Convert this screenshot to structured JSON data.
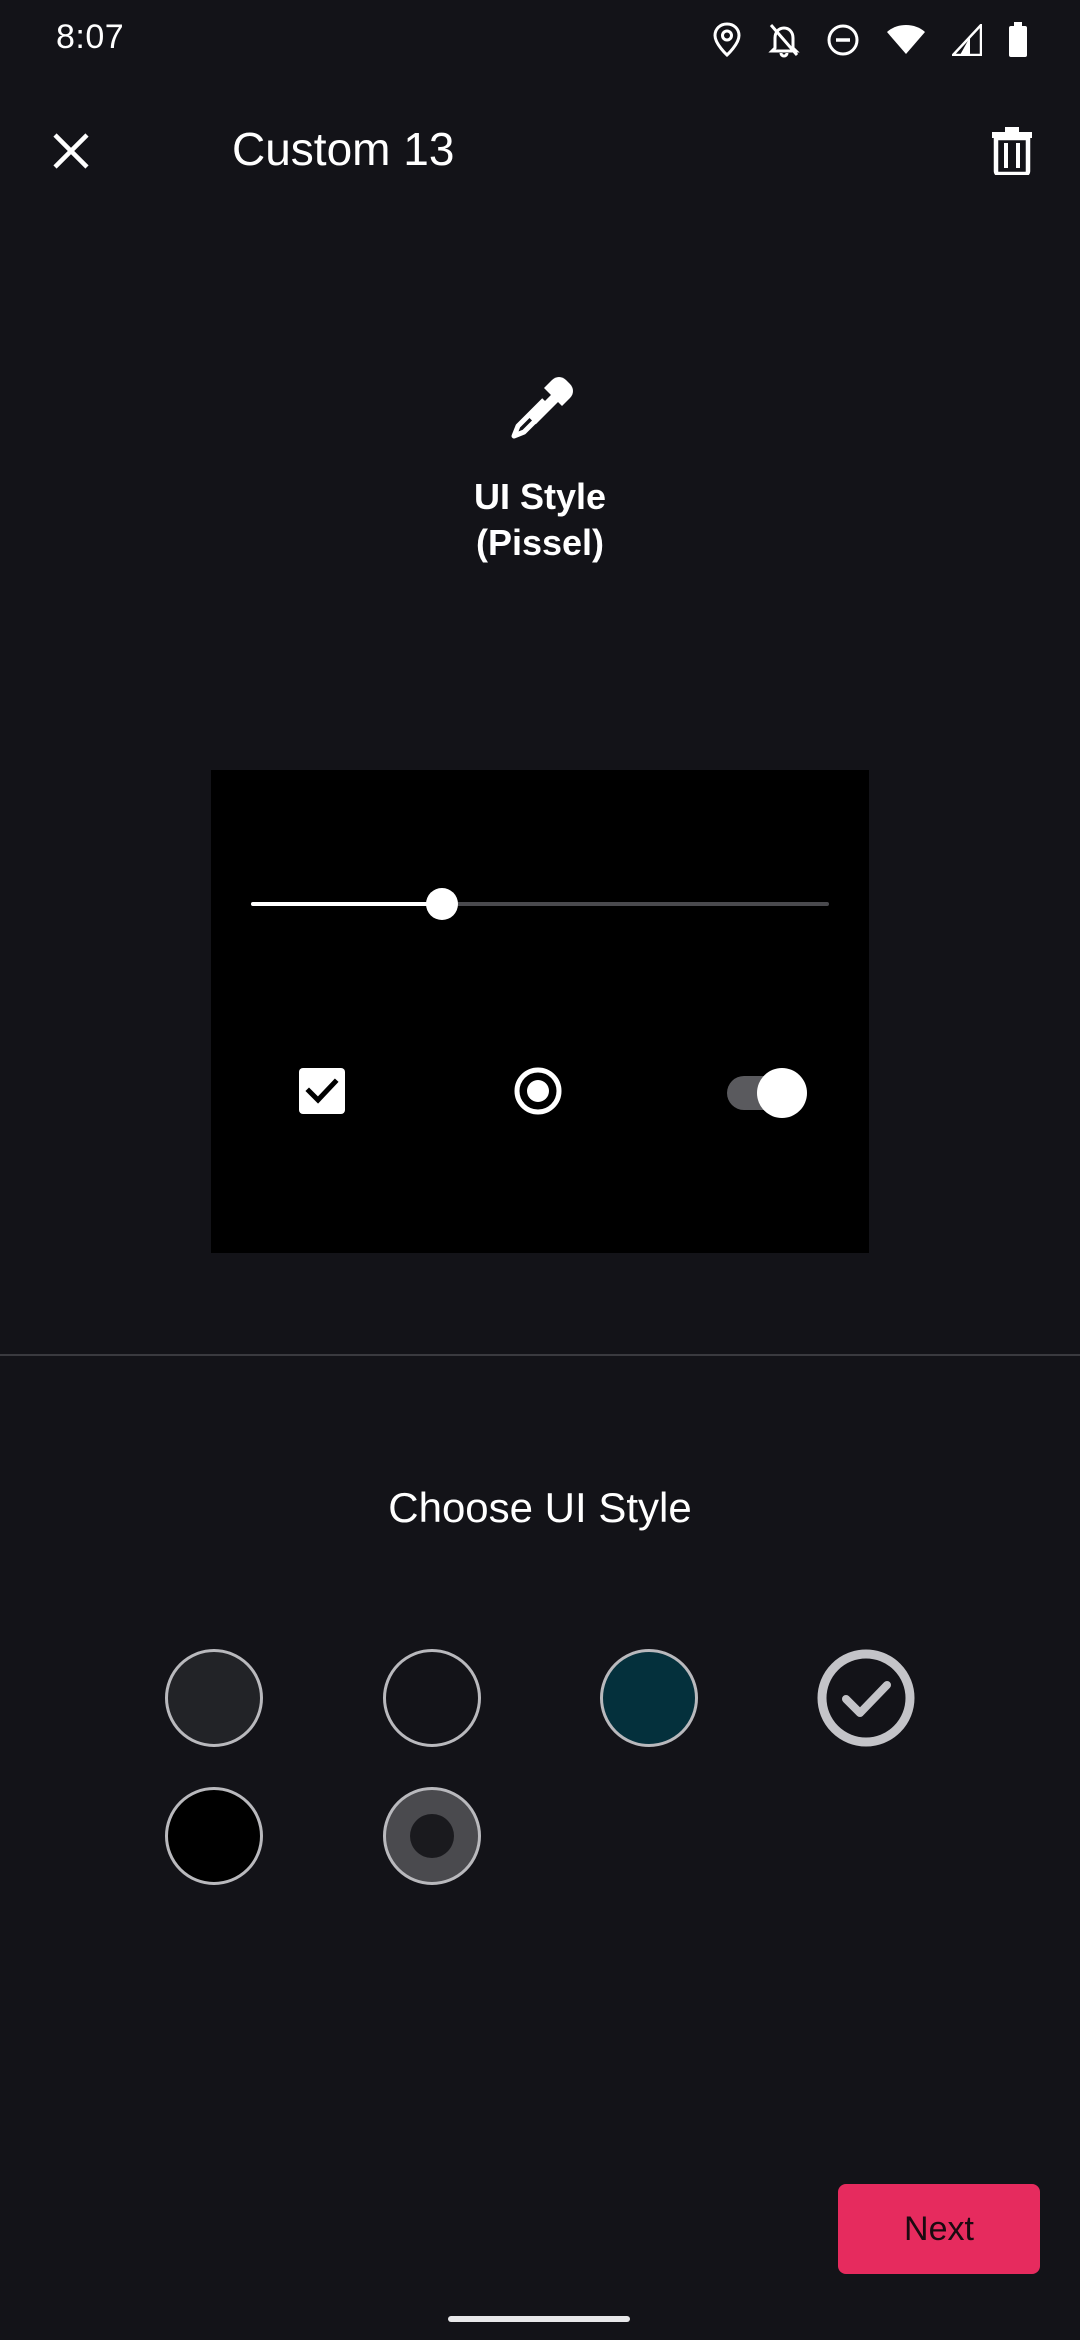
{
  "status_bar": {
    "time": "8:07",
    "icons": [
      "location-icon",
      "notifications-off-icon",
      "do-not-disturb-icon",
      "wifi-icon",
      "signal-icon",
      "battery-icon"
    ]
  },
  "app_bar": {
    "title": "Custom 13",
    "close_icon": "close-icon",
    "delete_icon": "trash-icon"
  },
  "header": {
    "icon": "eyedropper-icon",
    "style_name": "UI Style\n(Pissel)"
  },
  "preview": {
    "slider_value_fraction": 0.33,
    "checkbox_checked": true,
    "radio_selected": true,
    "toggle_on": true
  },
  "choose": {
    "title": "Choose UI Style",
    "swatches": [
      {
        "name": "swatch-1",
        "color": "#222327",
        "selected": false
      },
      {
        "name": "swatch-2",
        "color": "#131318",
        "selected": false
      },
      {
        "name": "swatch-3",
        "color": "#04303c",
        "selected": false
      },
      {
        "name": "swatch-4",
        "color": "#131318",
        "selected": true
      },
      {
        "name": "swatch-5",
        "color": "#000000",
        "selected": false
      },
      {
        "name": "swatch-6",
        "color": "#4a4a4e",
        "selected": false
      }
    ]
  },
  "footer": {
    "next_label": "Next",
    "accent_color": "#e62b5e"
  }
}
